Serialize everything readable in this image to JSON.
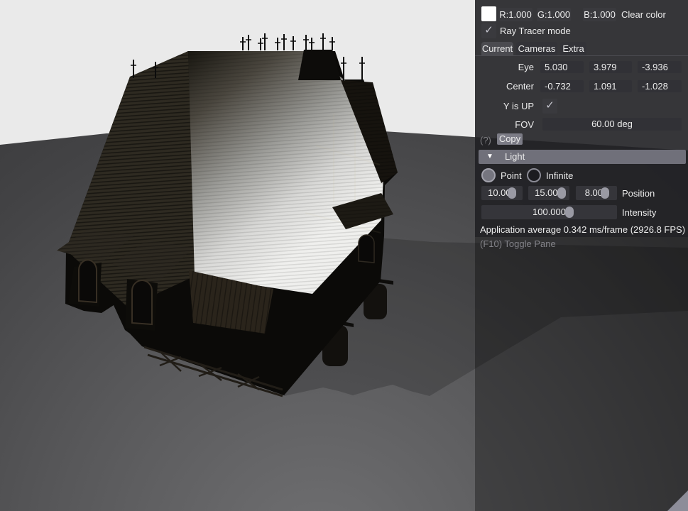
{
  "colors": {
    "sky": "#eaeaea",
    "ground_light": "#707072",
    "ground_dark": "#3a3a3c",
    "ground_edge_corner": "#d2d2e4",
    "panel_window_bg": "rgba(34,34,38,0.84)",
    "pane_backdrop": "rgba(0,0,0,0.33)",
    "field_bg": "#313136",
    "header_bg": "#70707a",
    "copy_button_bg": "#7c7c86",
    "slider_grab": "#9a9aa4",
    "text": "#ececec",
    "text_dim": "#84848a",
    "clear_color_swatch": "#ffffff"
  },
  "clear_color": {
    "r": "R:1.000",
    "g": "G:1.000",
    "b": "B:1.000",
    "label": "Clear color"
  },
  "ray_tracer": {
    "label": "Ray Tracer mode",
    "check_glyph": "✓",
    "checked": true
  },
  "tabs": [
    {
      "label": "Current",
      "active": true
    },
    {
      "label": "Cameras",
      "active": false
    },
    {
      "label": "Extra",
      "active": false
    }
  ],
  "camera": {
    "eye_label": "Eye",
    "eye": [
      "5.030",
      "3.979",
      "-3.936"
    ],
    "center_label": "Center",
    "center": [
      "-0.732",
      "1.091",
      "-1.028"
    ],
    "y_up_label": "Y is UP",
    "y_up_check_glyph": "✓",
    "y_up_checked": true,
    "fov_label": "FOV",
    "fov_value": "60.00 deg",
    "help_glyph": "(?)",
    "copy_label": "Copy"
  },
  "light": {
    "header_label": "Light",
    "collapse_glyph": "▼",
    "options": [
      {
        "label": "Point",
        "selected": true
      },
      {
        "label": "Infinite",
        "selected": false
      }
    ],
    "position": {
      "values": [
        "10.000",
        "15.000",
        "8.000"
      ],
      "label": "Position"
    },
    "intensity": {
      "value": "100.000",
      "label": "Intensity"
    }
  },
  "status": {
    "perf": "Application average 0.342 ms/frame (2926.8 FPS)",
    "hint": "(F10) Toggle Pane"
  }
}
